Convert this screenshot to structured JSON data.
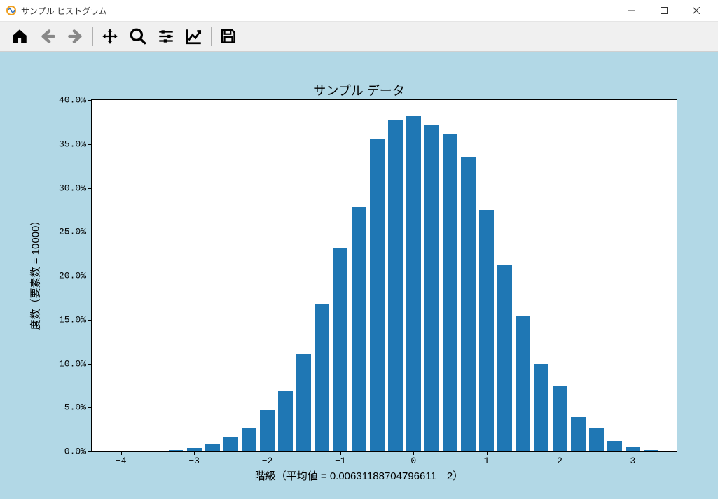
{
  "window": {
    "title": "サンプル ヒストグラム"
  },
  "toolbar": {
    "home": "home-icon",
    "back": "arrow-left-icon",
    "forward": "arrow-right-icon",
    "pan": "move-icon",
    "zoom": "zoom-icon",
    "configure": "sliders-icon",
    "edit": "chart-line-icon",
    "save": "save-icon"
  },
  "chart_data": {
    "type": "bar",
    "title": "サンプル データ",
    "xlabel": "階級（平均値 = 0.00631188704796611　2）",
    "ylabel": "度数（要素数 = 10000）",
    "xlim": [
      -4.4,
      3.6
    ],
    "ylim": [
      0,
      40
    ],
    "xticks": [
      -4,
      -3,
      -2,
      -1,
      0,
      1,
      2,
      3
    ],
    "yticks": [
      0.0,
      5.0,
      10.0,
      15.0,
      20.0,
      25.0,
      30.0,
      35.0,
      40.0
    ],
    "ytick_labels": [
      "0.0%",
      "5.0%",
      "10.0%",
      "15.0%",
      "20.0%",
      "25.0%",
      "30.0%",
      "35.0%",
      "40.0%"
    ],
    "bin_width": 0.25,
    "categories": [
      -4.0,
      -3.75,
      -3.5,
      -3.25,
      -3.0,
      -2.75,
      -2.5,
      -2.25,
      -2.0,
      -1.75,
      -1.5,
      -1.25,
      -1.0,
      -0.75,
      -0.5,
      -0.25,
      0.0,
      0.25,
      0.5,
      0.75,
      1.0,
      1.25,
      1.5,
      1.75,
      2.0,
      2.25,
      2.5,
      2.75,
      3.0,
      3.25
    ],
    "values": [
      0.1,
      0.0,
      0.0,
      0.2,
      0.4,
      0.8,
      1.7,
      2.7,
      4.7,
      6.9,
      11.1,
      16.8,
      23.1,
      27.8,
      35.5,
      37.8,
      38.2,
      37.2,
      36.2,
      33.5,
      27.5,
      21.3,
      15.4,
      10.0,
      7.4,
      3.9,
      2.7,
      1.2,
      0.5,
      0.2
    ]
  }
}
